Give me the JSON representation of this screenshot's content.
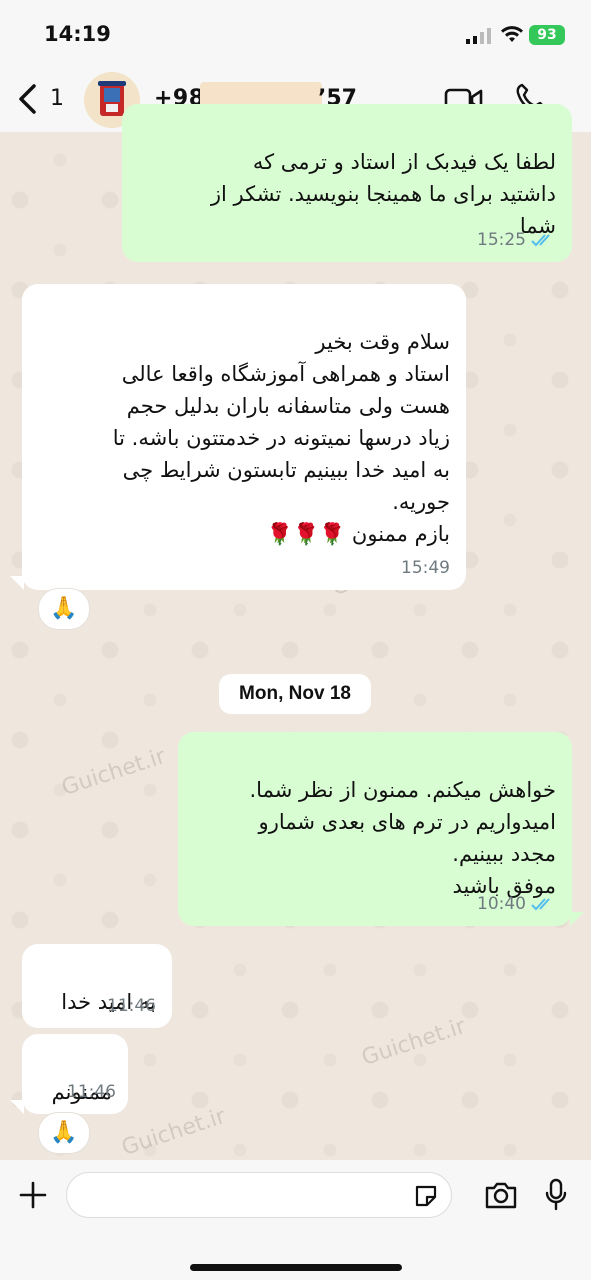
{
  "status_bar": {
    "time": "14:19",
    "battery": "93"
  },
  "header": {
    "back_count": "1",
    "phone_prefix": "+98",
    "phone_suffix": "’57"
  },
  "messages": [
    {
      "id": "m1",
      "direction": "out",
      "text": "لطفا یک فیدبک از استاد و ترمی که\nداشتید برای ما همینجا بنویسید. تشکر از\nشما",
      "time": "15:25",
      "read": true
    },
    {
      "id": "m2",
      "direction": "in",
      "text": "سلام وقت بخیر\nاستاد و همراهی آموزشگاه واقعا عالی\nهست ولی متاسفانه باران بدلیل حجم\nزیاد درسها نمیتونه در خدمتتون باشه.  تا\nبه امید خدا ببینیم تابستون شرایط چی\nجوریه.\nبازم ممنون 🌹🌹🌹",
      "time": "15:49",
      "reaction": "🙏"
    },
    {
      "id": "m3",
      "direction": "out",
      "text": "خواهش میکنم. ممنون از نظر شما.\nامیدواریم در ترم های بعدی شمارو\nمجدد ببینیم.\nموفق باشید",
      "time": "10:40",
      "read": true
    },
    {
      "id": "m4",
      "direction": "in",
      "text": "به امید خدا",
      "time": "11:46"
    },
    {
      "id": "m5",
      "direction": "in",
      "text": "ممنونم",
      "time": "11:46",
      "reaction": "🙏"
    }
  ],
  "date_divider": "Mon, Nov 18",
  "watermark_text": "Guichet.ir",
  "colors": {
    "outgoing": "#d9fdd3",
    "incoming": "#ffffff",
    "read_ticks": "#53bdeb",
    "battery": "#34c759"
  },
  "icons": {
    "back": "chevron-left-icon",
    "video": "video-camera-icon",
    "call": "phone-icon",
    "plus": "plus-icon",
    "sticker": "sticker-icon",
    "camera": "camera-icon",
    "mic": "microphone-icon"
  }
}
